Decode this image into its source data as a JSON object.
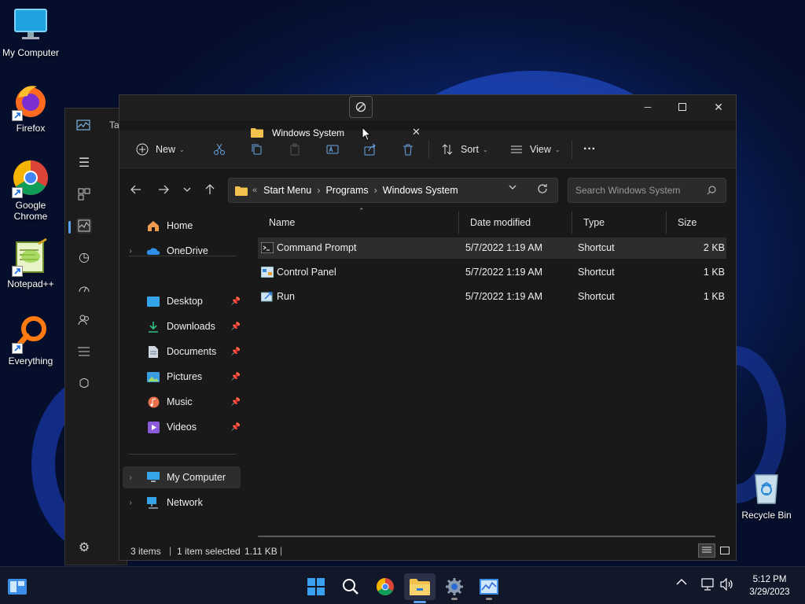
{
  "desktop": {
    "icons": [
      {
        "label": "My Computer",
        "icon": "monitor-icon"
      },
      {
        "label": "Firefox",
        "icon": "firefox-icon"
      },
      {
        "label": "Google Chrome",
        "icon": "chrome-icon"
      },
      {
        "label": "Notepad++",
        "icon": "notepadpp-icon"
      },
      {
        "label": "Everything",
        "icon": "everything-icon"
      },
      {
        "label": "Recycle Bin",
        "icon": "recycle-bin-icon"
      }
    ]
  },
  "background_window": {
    "partial_title": "Ta"
  },
  "explorer": {
    "tab": {
      "title": "Windows System",
      "new_tab": "+"
    },
    "window_controls": {
      "minimize": "─",
      "maximize": "☐",
      "close": "✕"
    },
    "toolbar": {
      "new_label": "New",
      "sort_label": "Sort",
      "view_label": "View",
      "more_label": "···"
    },
    "address": {
      "overflow": "«",
      "crumbs": [
        "Start Menu",
        "Programs",
        "Windows System"
      ],
      "separator": "›"
    },
    "search": {
      "placeholder": "Search Windows System"
    },
    "nav": {
      "home": "Home",
      "onedrive": "OneDrive",
      "quick": [
        "Desktop",
        "Downloads",
        "Documents",
        "Pictures",
        "Music",
        "Videos"
      ],
      "my_computer": "My Computer",
      "network": "Network"
    },
    "columns": {
      "name": "Name",
      "date": "Date modified",
      "type": "Type",
      "size": "Size"
    },
    "files": [
      {
        "name": "Command Prompt",
        "date": "5/7/2022 1:19 AM",
        "type": "Shortcut",
        "size": "2 KB",
        "selected": true
      },
      {
        "name": "Control Panel",
        "date": "5/7/2022 1:19 AM",
        "type": "Shortcut",
        "size": "1 KB",
        "selected": false
      },
      {
        "name": "Run",
        "date": "5/7/2022 1:19 AM",
        "type": "Shortcut",
        "size": "1 KB",
        "selected": false
      }
    ],
    "status": {
      "items": "3 items",
      "selected": "1 item selected",
      "size": "1.11 KB"
    }
  },
  "taskbar": {
    "clock_time": "5:12 PM",
    "clock_date": "3/29/2023",
    "apps": [
      "start-icon",
      "search-icon",
      "chrome-icon",
      "file-explorer-icon",
      "settings-icon",
      "task-manager-icon"
    ]
  },
  "colors": {
    "accent": "#3b8eea",
    "folder": "#f2c14e",
    "window_bg": "#191919",
    "taskbar_bg": "#121829"
  }
}
